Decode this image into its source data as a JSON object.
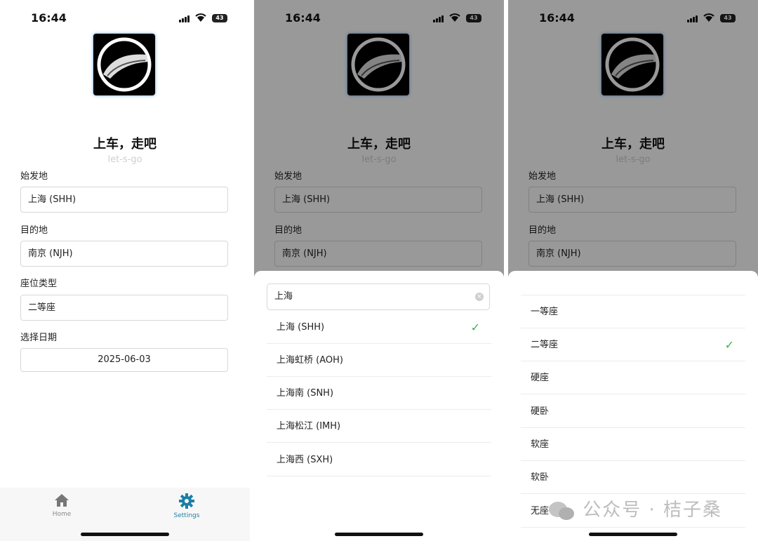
{
  "status": {
    "time": "16:44",
    "battery": "43"
  },
  "app": {
    "title": "上车，走吧",
    "subtitle": "let-s-go"
  },
  "form": {
    "origin_label": "始发地",
    "origin_value": "上海 (SHH)",
    "dest_label": "目的地",
    "dest_value": "南京 (NJH)",
    "seat_label": "座位类型",
    "seat_value": "二等座",
    "date_label": "选择日期",
    "date_value": "2025-06-03"
  },
  "tabs": [
    {
      "label": "Home",
      "icon": "home-icon",
      "active": false
    },
    {
      "label": "Settings",
      "icon": "gear-icon",
      "active": true
    }
  ],
  "colors": {
    "accent": "#1b7fa6",
    "check": "#3bb24a"
  },
  "station_picker": {
    "search_value": "上海",
    "options": [
      "上海 (SHH)",
      "上海虹桥 (AOH)",
      "上海南 (SNH)",
      "上海松江 (IMH)",
      "上海西 (SXH)"
    ],
    "selected": "上海 (SHH)"
  },
  "seat_picker": {
    "options": [
      "一等座",
      "二等座",
      "硬座",
      "硬卧",
      "软座",
      "软卧",
      "无座"
    ],
    "selected": "二等座"
  },
  "watermark": "公众号 · 桔子桑"
}
